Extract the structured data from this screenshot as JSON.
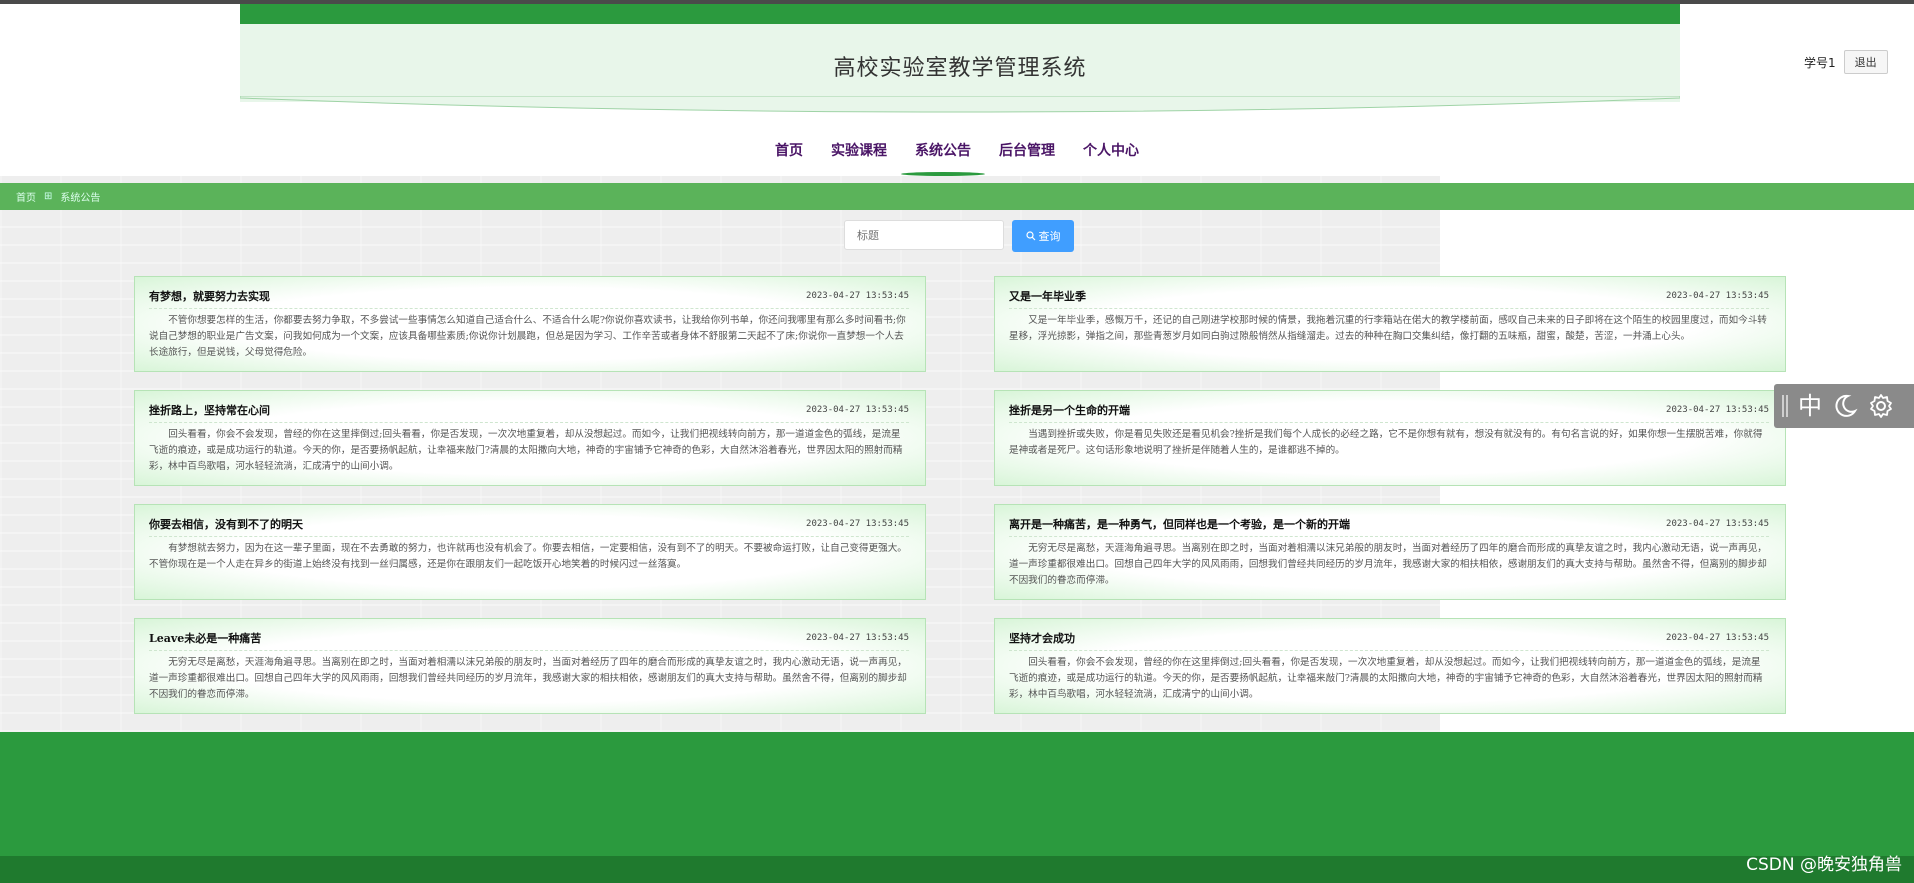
{
  "header": {
    "title": "高校实验室教学管理系统"
  },
  "user": {
    "name": "学号1",
    "logout_label": "退出"
  },
  "nav": {
    "items": [
      {
        "label": "首页"
      },
      {
        "label": "实验课程"
      },
      {
        "label": "系统公告",
        "active": true
      },
      {
        "label": "后台管理"
      },
      {
        "label": "个人中心"
      }
    ]
  },
  "breadcrumb": {
    "home": "首页",
    "separator": "⊞",
    "current": "系统公告"
  },
  "search": {
    "placeholder": "标题",
    "button_label": "查询"
  },
  "announcements": [
    {
      "title": "有梦想，就要努力去实现",
      "date": "2023-04-27 13:53:45",
      "body": "不管你想要怎样的生活，你都要去努力争取，不多尝试一些事情怎么知道自己适合什么、不适合什么呢?你说你喜欢读书，让我给你列书单，你还问我哪里有那么多时间看书;你说自己梦想的职业是广告文案，问我如何成为一个文案，应该具备哪些素质;你说你计划晨跑，但总是因为学习、工作辛苦或者身体不舒服第二天起不了床;你说你一直梦想一个人去长途旅行，但是说钱，父母觉得危险。"
    },
    {
      "title": "又是一年毕业季",
      "date": "2023-04-27 13:53:45",
      "body": "又是一年毕业季，感慨万千，还记的自己刚进学校那时候的情景，我拖着沉重的行李箱站在偌大的教学楼前面，感叹自己未来的日子即将在这个陌生的校园里度过，而如今斗转星移，浮光掠影，弹指之间，那些青葱岁月如同白驹过隙般悄然从指缝溜走。过去的种种在胸口交集纠结，像打翻的五味瓶，甜蜜，酸楚，苦涩，一并涌上心头。"
    },
    {
      "title": "挫折路上，坚持常在心间",
      "date": "2023-04-27 13:53:45",
      "body": "回头看看，你会不会发现，曾经的你在这里摔倒过;回头看看，你是否发现，一次次地重复着，却从没想起过。而如今，让我们把视线转向前方，那一道道金色的弧线，是流星飞逝的痕迹，或是成功运行的轨道。今天的你，是否要扬帆起航，让幸福来敲门?清晨的太阳撒向大地，神奇的宇宙铺予它神奇的色彩，大自然沐浴着春光，世界因太阳的照射而精彩，林中百鸟歌唱，河水轻轻流淌，汇成清宁的山间小调。"
    },
    {
      "title": "挫折是另一个生命的开端",
      "date": "2023-04-27 13:53:45",
      "body": "当遇到挫折或失败，你是看见失败还是看见机会?挫折是我们每个人成长的必经之路，它不是你想有就有，想没有就没有的。有句名言说的好，如果你想一生摆脱苦难，你就得是神或者是死尸。这句话形象地说明了挫折是伴随着人生的，是谁都逃不掉的。"
    },
    {
      "title": "你要去相信，没有到不了的明天",
      "date": "2023-04-27 13:53:45",
      "body": "有梦想就去努力，因为在这一辈子里面，现在不去勇敢的努力，也许就再也没有机会了。你要去相信，一定要相信，没有到不了的明天。不要被命运打败，让自己变得更强大。不管你现在是一个人走在异乡的街道上始终没有找到一丝归属感，还是你在跟朋友们一起吃饭开心地笑着的时候闪过一丝落寞。"
    },
    {
      "title": "离开是一种痛苦，是一种勇气，但同样也是一个考验，是一个新的开端",
      "date": "2023-04-27 13:53:45",
      "body": "无穷无尽是离愁，天涯海角遍寻思。当离别在即之时，当面对着相濡以沫兄弟般的朋友时，当面对着经历了四年的磨合而形成的真挚友谊之时，我内心激动无语，说一声再见，道一声珍重都很难出口。回想自己四年大学的风风雨雨，回想我们曾经共同经历的岁月流年，我感谢大家的相扶相依，感谢朋友们的真大支持与帮助。虽然舍不得，但离别的脚步却不因我们的眷恋而停滞。"
    },
    {
      "title": "Leave未必是一种痛苦",
      "date": "2023-04-27 13:53:45",
      "body": "无穷无尽是离愁，天涯海角遍寻思。当离别在即之时，当面对着相濡以沫兄弟般的朋友时，当面对着经历了四年的磨合而形成的真挚友谊之时，我内心激动无语，说一声再见，道一声珍重都很难出口。回想自己四年大学的风风雨雨，回想我们曾经共同经历的岁月流年，我感谢大家的相扶相依，感谢朋友们的真大支持与帮助。虽然舍不得，但离别的脚步却不因我们的眷恋而停滞。"
    },
    {
      "title": "坚持才会成功",
      "date": "2023-04-27 13:53:45",
      "body": "回头看看，你会不会发现，曾经的你在这里摔倒过;回头看看，你是否发现，一次次地重复着，却从没想起过。而如今，让我们把视线转向前方，那一道道金色的弧线，是流星飞逝的痕迹，或是成功运行的轨道。今天的你，是否要扬帆起航，让幸福来敲门?清晨的太阳撒向大地，神奇的宇宙铺予它神奇的色彩，大自然沐浴着春光，世界因太阳的照射而精彩，林中百鸟歌唱，河水轻轻流淌，汇成清宁的山间小调。"
    }
  ],
  "float_tools": {
    "lang_label": "中",
    "icons": [
      "moon-icon",
      "gear-icon"
    ]
  },
  "watermark": "CSDN @晚安独角兽",
  "colors": {
    "primary_green": "#2b9a3e",
    "breadcrumb_green": "#5bb35a",
    "search_button_blue": "#409eff",
    "nav_text": "#4a1566"
  }
}
